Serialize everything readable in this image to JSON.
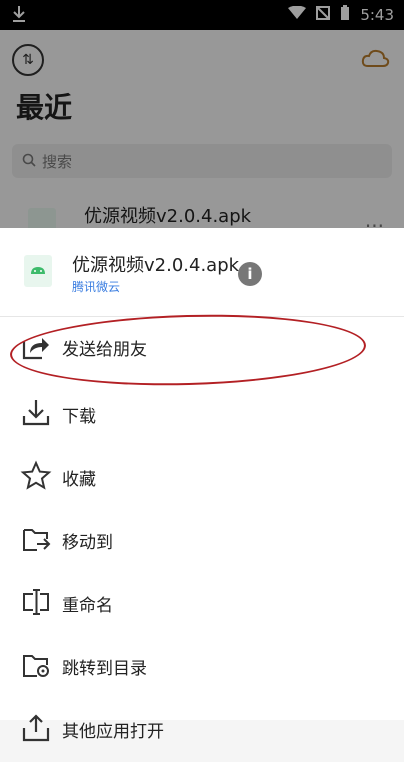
{
  "status_bar": {
    "time": "5:43",
    "left_icon": "download-icon",
    "right_icons": [
      "wifi-icon",
      "no-signal-icon",
      "battery-icon"
    ]
  },
  "background": {
    "title": "最近",
    "search_placeholder": "搜索",
    "file_name": "优源视频v2.0.4.apk",
    "more_label": "···"
  },
  "sheet": {
    "file_name": "优源视频v2.0.4.apk",
    "source": "腾讯微云",
    "info_label": "i",
    "menu": [
      {
        "label": "发送给朋友",
        "icon": "share-icon"
      },
      {
        "label": "下载",
        "icon": "download-icon"
      },
      {
        "label": "收藏",
        "icon": "star-icon"
      },
      {
        "label": "移动到",
        "icon": "move-folder-icon"
      },
      {
        "label": "重命名",
        "icon": "rename-icon"
      },
      {
        "label": "跳转到目录",
        "icon": "folder-location-icon"
      },
      {
        "label": "其他应用打开",
        "icon": "open-with-icon"
      }
    ]
  },
  "colors": {
    "accent_blue": "#3a7de0",
    "annotation_red": "#b32024"
  }
}
